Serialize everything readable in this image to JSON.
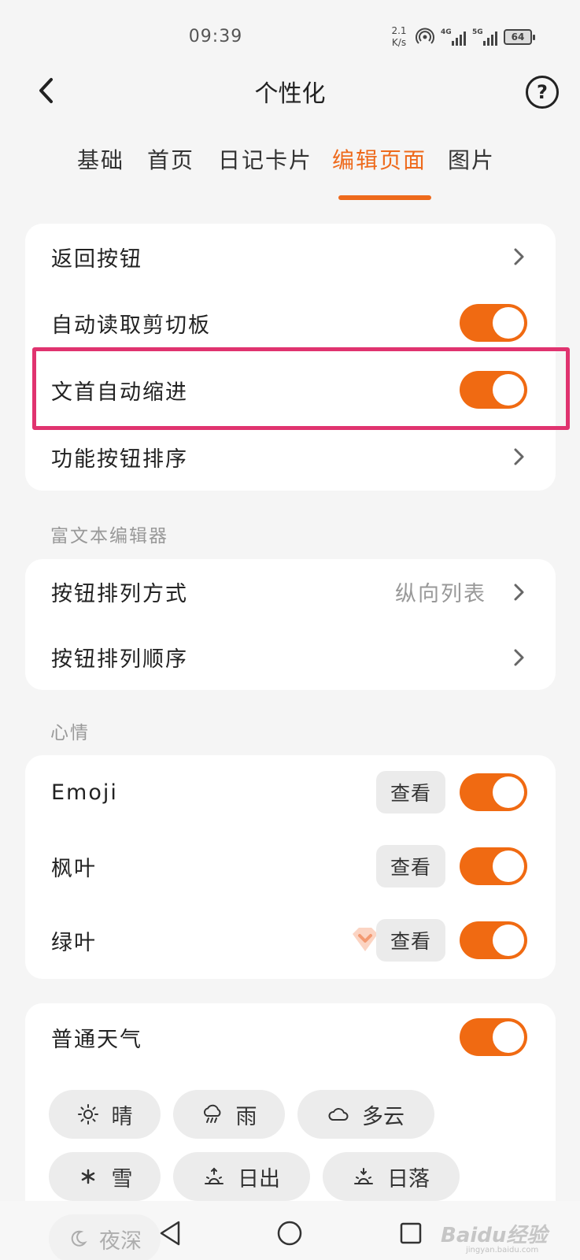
{
  "status_bar": {
    "time": "09:39",
    "net_speed_value": "2.1",
    "net_speed_unit": "K/s",
    "signal_1": "4G",
    "signal_2": "5G",
    "battery": "64"
  },
  "header": {
    "title": "个性化",
    "help": "?"
  },
  "tabs": [
    {
      "label": "基础",
      "active": false
    },
    {
      "label": "首页",
      "active": false
    },
    {
      "label": "日记卡片",
      "active": false
    },
    {
      "label": "编辑页面",
      "active": true
    },
    {
      "label": "图片",
      "active": false
    }
  ],
  "editor_card": {
    "rows": [
      {
        "label": "返回按钮",
        "control": "chevron"
      },
      {
        "label": "自动读取剪切板",
        "control": "toggle",
        "on": true
      },
      {
        "label": "文首自动缩进",
        "control": "toggle",
        "on": true
      },
      {
        "label": "功能按钮排序",
        "control": "chevron"
      }
    ]
  },
  "rich_text_section": {
    "title": "富文本编辑器",
    "rows": [
      {
        "label": "按钮排列方式",
        "value": "纵向列表",
        "control": "chevron"
      },
      {
        "label": "按钮排列顺序",
        "control": "chevron"
      }
    ]
  },
  "mood_section": {
    "title": "心情",
    "view_label": "查看",
    "rows": [
      {
        "label": "Emoji",
        "on": true,
        "premium": false
      },
      {
        "label": "枫叶",
        "on": true,
        "premium": true
      },
      {
        "label": "绿叶",
        "on": true,
        "premium": true
      }
    ]
  },
  "weather_card": {
    "label": "普通天气",
    "on": true,
    "chips": [
      {
        "label": "晴",
        "icon": "sun-icon"
      },
      {
        "label": "雨",
        "icon": "rain-cloud-icon"
      },
      {
        "label": "多云",
        "icon": "cloud-icon"
      },
      {
        "label": "雪",
        "icon": "snowflake-icon"
      },
      {
        "label": "日出",
        "icon": "sunrise-icon"
      },
      {
        "label": "日落",
        "icon": "sunset-icon"
      },
      {
        "label": "夜深",
        "icon": "moon-icon"
      }
    ]
  },
  "watermark": {
    "text": "Baidu经验",
    "sub": "jingyan.baidu.com"
  },
  "colors": {
    "accent": "#ee6a1c",
    "toggle_on": "#f06a12",
    "highlight_border": "#e0336f",
    "background": "#f5f5f5"
  }
}
